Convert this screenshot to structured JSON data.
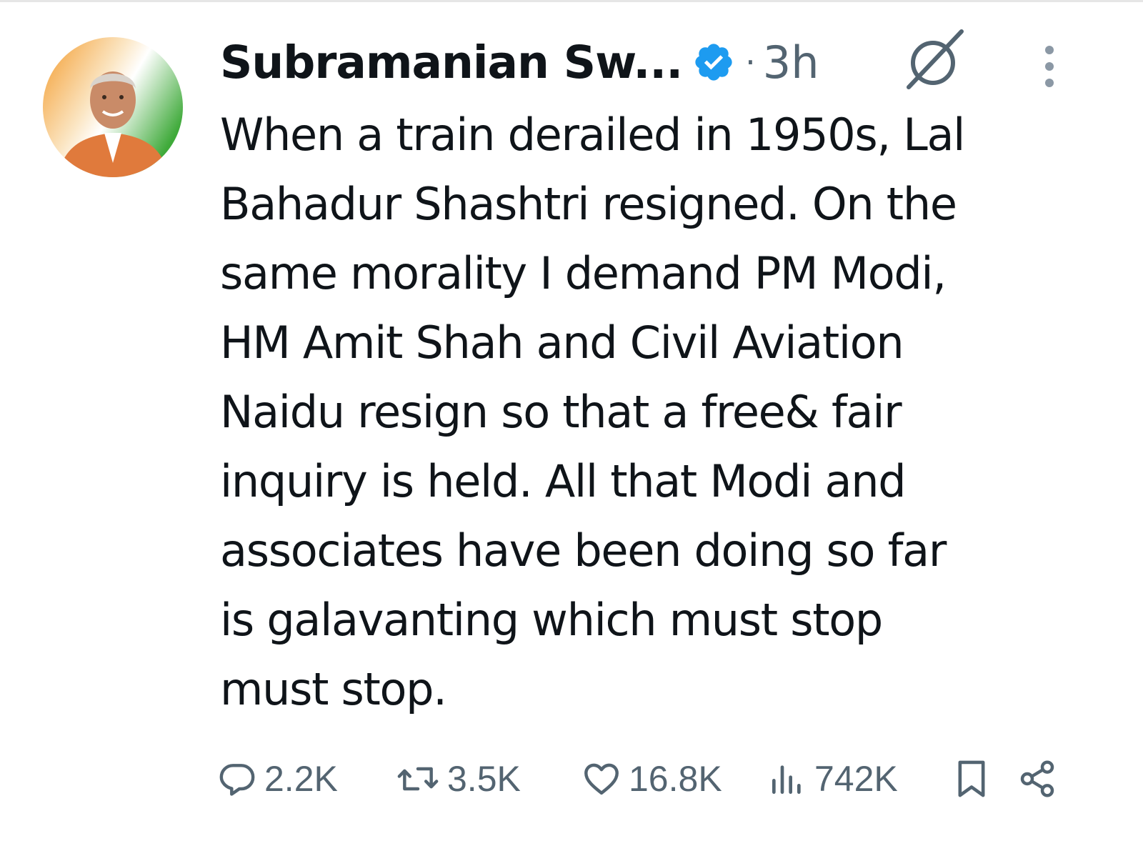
{
  "tweet": {
    "author": {
      "name": "Subramanian Sw...",
      "verified": true,
      "avatar_icon": "profile-photo"
    },
    "separator": "·",
    "time": "3h",
    "header_icons": {
      "grok": "grok-icon",
      "more": "more-vertical-icon"
    },
    "text_lines": [
      "When a train derailed in 1950s, Lal",
      "Bahadur Shashtri resigned. On the",
      "same morality I demand PM Modi,",
      "HM Amit Shah and Civil Aviation",
      "Naidu resign so that a free& fair",
      "inquiry is held. All that Modi and",
      "associates have been doing so far",
      "is galavanting which must stop",
      "must stop."
    ],
    "actions": {
      "replies": "2.2K",
      "retweets": "3.5K",
      "likes": "16.8K",
      "views": "742K"
    }
  },
  "colors": {
    "text": "#0f1419",
    "secondary": "#536471",
    "verified_blue": "#1d9bf0",
    "divider": "#e6e6e6"
  }
}
